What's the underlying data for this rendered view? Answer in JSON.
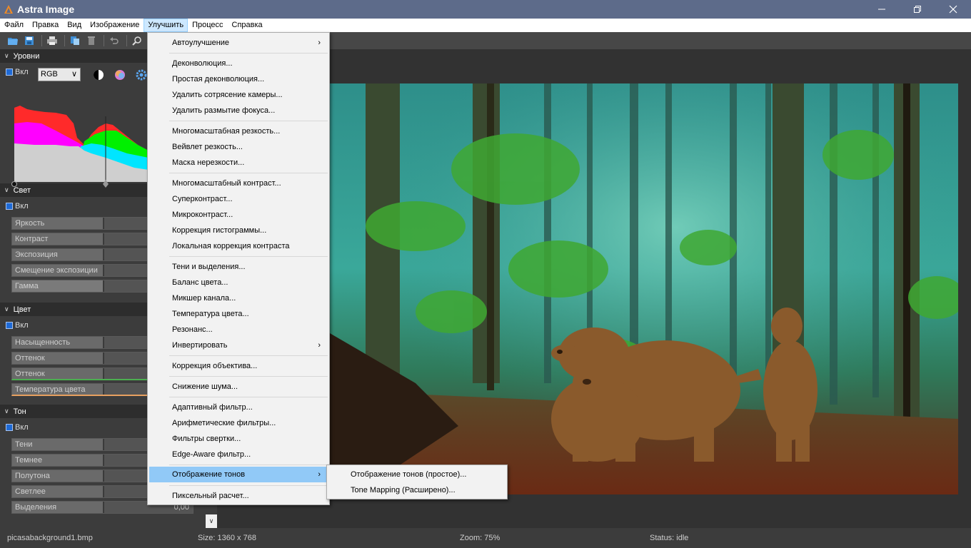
{
  "window": {
    "title": "Astra Image",
    "controls": [
      "minimize-icon",
      "maximize-icon",
      "close-icon"
    ]
  },
  "menubar": {
    "items": [
      "Файл",
      "Правка",
      "Вид",
      "Изображение",
      "Улучшить",
      "Процесс",
      "Справка"
    ],
    "active": "Улучшить"
  },
  "toolbar": {
    "icons": [
      "open-folder-icon",
      "save-icon",
      "print-icon",
      "copy-icon",
      "delete-icon",
      "undo-icon",
      "zoom-icon"
    ]
  },
  "panel": {
    "levels": {
      "header": "Уровни",
      "enable": "Вкл",
      "channel": "RGB",
      "icons": [
        "contrast-icon",
        "color-wheel-icon",
        "settings-gear-icon"
      ]
    },
    "light": {
      "header": "Свет",
      "enable": "Вкл",
      "sliders": [
        "Яркость",
        "Контраст",
        "Экспозиция",
        "Смещение экспозиции",
        "Гамма"
      ]
    },
    "color": {
      "header": "Цвет",
      "enable": "Вкл",
      "sliders": [
        "Насыщенность",
        "Оттенок",
        "Оттенок",
        "Температура цвета"
      ]
    },
    "tone": {
      "header": "Тон",
      "enable": "Вкл",
      "sliders": [
        "Тени",
        "Темнее",
        "Полутона",
        "Светлее",
        "Выделения"
      ],
      "last_value": "0,00"
    }
  },
  "menu_enhance": {
    "items": [
      "Автоулучшение",
      "Деконволюция...",
      "Простая деконволюция...",
      "Удалить сотрясение камеры...",
      "Удалить размытие фокуса...",
      "Многомасштабная резкость...",
      "Вейвлет резкость...",
      "Маска нерезкости...",
      "Многомасштабный контраст...",
      "Суперконтраст...",
      "Микроконтраст...",
      "Коррекция гистограммы...",
      "Локальная коррекция контраста",
      "Тени и выделения...",
      "Баланс цвета...",
      "Микшер канала...",
      "Температура цвета...",
      "Резонанс...",
      "Инвертировать",
      "Коррекция объектива...",
      "Снижение шума...",
      "Адаптивный фильтр...",
      "Арифметические фильтры...",
      "Фильтры свертки...",
      "Edge-Aware фильтр...",
      "Отображение тонов",
      "Пиксельный расчет..."
    ],
    "highlighted": "Отображение тонов"
  },
  "submenu_tone": {
    "items": [
      "Отображение тонов (простое)...",
      "Tone Mapping (Расширено)..."
    ]
  },
  "statusbar": {
    "filename": "picasabackground1.bmp",
    "size": "Size: 1360 x 768",
    "zoom": "Zoom: 75%",
    "status": "Status: idle"
  }
}
